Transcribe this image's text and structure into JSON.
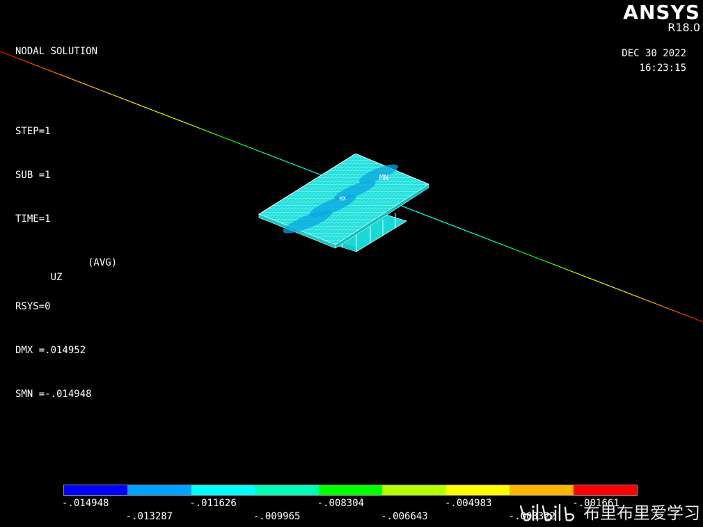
{
  "info": {
    "title": "NODAL SOLUTION",
    "step": "STEP=1",
    "sub": "SUB =1",
    "time": "TIME=1",
    "uz": "UZ",
    "avg": "(AVG)",
    "rsys": "RSYS=0",
    "dmx": "DMX =.014952",
    "smn": "SMN =-.014948"
  },
  "brand": {
    "name": "ANSYS",
    "version": "R18.0"
  },
  "datetime": {
    "date": "DEC 30 2022",
    "time": "16:23:15"
  },
  "model": {
    "mn_label": "MN",
    "mx_label": "MX"
  },
  "legend": {
    "colors": [
      "#0000ff",
      "#00a2ff",
      "#00ffff",
      "#00ffb4",
      "#00ff00",
      "#b4ff00",
      "#ffff00",
      "#ffb400",
      "#ff0000"
    ],
    "labels": [
      "-.014948",
      "-.013287",
      "-.011626",
      "-.009965",
      "-.008304",
      "-.006643",
      "-.004983",
      "-.003322",
      "-.001661"
    ]
  },
  "watermark": {
    "logo_icon": "bilibili-logo-icon",
    "text": "布里布里爱学习"
  }
}
